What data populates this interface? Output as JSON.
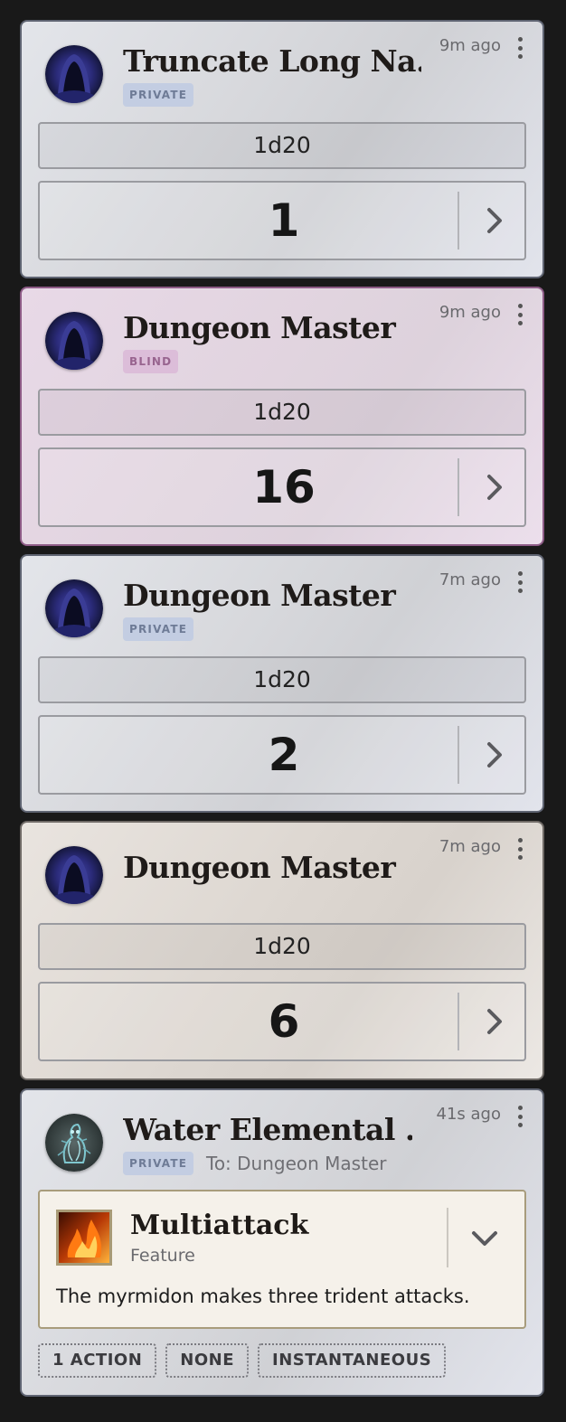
{
  "rolls": [
    {
      "name": "Truncate Long Na…",
      "badge": "PRIVATE",
      "time": "9m ago",
      "dice": "1d20",
      "result": "1"
    },
    {
      "name": "Dungeon Master",
      "badge": "BLIND",
      "time": "9m ago",
      "dice": "1d20",
      "result": "16"
    },
    {
      "name": "Dungeon Master",
      "badge": "PRIVATE",
      "time": "7m ago",
      "dice": "1d20",
      "result": "2"
    },
    {
      "name": "Dungeon Master",
      "time": "7m ago",
      "dice": "1d20",
      "result": "6"
    }
  ],
  "feature_card": {
    "name": "Water Elemental …",
    "badge": "PRIVATE",
    "to": "To: Dungeon Master",
    "time": "41s ago",
    "title": "Multiattack",
    "type": "Feature",
    "description": "The myrmidon makes three trident attacks.",
    "tags": [
      "1 ACTION",
      "NONE",
      "INSTANTANEOUS"
    ]
  },
  "icons": {
    "avatar": "hooded-figure-avatar",
    "feature_avatar": "water-elemental-avatar",
    "menu": "kebab-menu-icon",
    "expand": "chevron-right-icon",
    "collapse": "chevron-down-icon",
    "feature": "fire-icon"
  },
  "colors": {
    "background": "#191919",
    "private_badge": "#c3cde2",
    "blind_badge": "#dcbdd9",
    "blind_card": "#e3d5e1",
    "public_card": "#e0dbd5"
  }
}
